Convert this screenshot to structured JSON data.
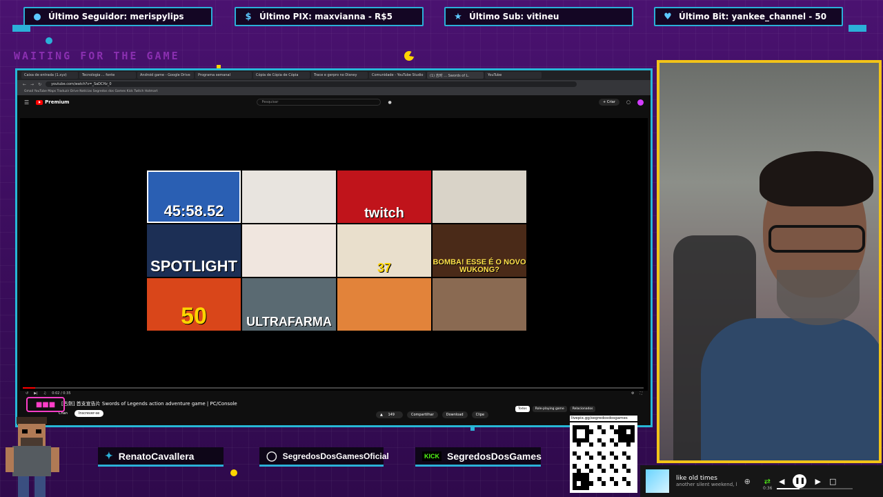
{
  "ticker": {
    "follower": "Último Seguidor: merispylips",
    "pix": "Último PIX: maxvianna - R$5",
    "sub": "Último Sub: vitineu",
    "bit": "Último Bit: yankee_channel - 50"
  },
  "overlay": {
    "waiting": "WAITING FOR THE GAME"
  },
  "browser": {
    "tabs": [
      "Caixa de entrada (1.xyz)",
      "Tecnologia ... fonte",
      "Android game - Google Drive",
      "Programa semanal",
      "Cópia de Cópia de Cópia",
      "Trace e gerpro no Disney",
      "Comunidade - YouTube Studio",
      "(1) 吉时 ... Swords of L.",
      "YouTube"
    ],
    "url": "youtube.com/watch?v=_SaDCHz_0",
    "bookmarks": "Gmail  YouTube  Maps  Traduzir  Drive  Notícias  Segredos dos Games  Kick  Twitch  Hotmart"
  },
  "youtube": {
    "logo": "Premium",
    "search_placeholder": "Pesquisar",
    "create": "Criar",
    "time": "0:02 / 0:35",
    "video_title": "[古劍] 首支宣告片 Swords of Legends action adventure game | PC/Console",
    "channel": "Chan",
    "subscribe": "Inscrever-se",
    "likes": "149",
    "share": "Compartilhar",
    "download": "Download",
    "clips": "Clipe",
    "chips": [
      "Todos",
      "Role-playing game",
      "Relacionados"
    ]
  },
  "thumbnails": [
    {
      "caption": "45:58.52",
      "bg": "#2a5fb3"
    },
    {
      "caption": "",
      "bg": "#e8e4df"
    },
    {
      "caption": "twitch",
      "bg": "#c0141b"
    },
    {
      "caption": "",
      "bg": "#d9d3c8"
    },
    {
      "caption": "SPOTLIGHT",
      "bg": "#1c2f55"
    },
    {
      "caption": "",
      "bg": "#f0e6df"
    },
    {
      "caption": "37",
      "bg": "#e9dfcc"
    },
    {
      "caption": "BOMBA! ESSE É O NOVO WUKONG?",
      "bg": "#4a2a18"
    },
    {
      "caption": "50",
      "bg": "#d9461a"
    },
    {
      "caption": "ULTRAFARMA",
      "bg": "#5a6a72"
    },
    {
      "caption": "",
      "bg": "#e2833a"
    },
    {
      "caption": "",
      "bg": "#8a6a52"
    }
  ],
  "social": {
    "twitter": "RenatoCavallera",
    "instagram": "SegredosDosGamesOficial",
    "kick_label": "KICK",
    "kick": "SegredosDosGames"
  },
  "qr": {
    "label": "livepix.gg/segredosdosgames"
  },
  "music": {
    "title": "like old times",
    "artist": "another silent weekend, l",
    "time": "0:36",
    "progress": 0.3
  },
  "colors": {
    "accent": "#2bb0d8",
    "webcam_border": "#f2c418",
    "bg": "#3a0f5a"
  }
}
